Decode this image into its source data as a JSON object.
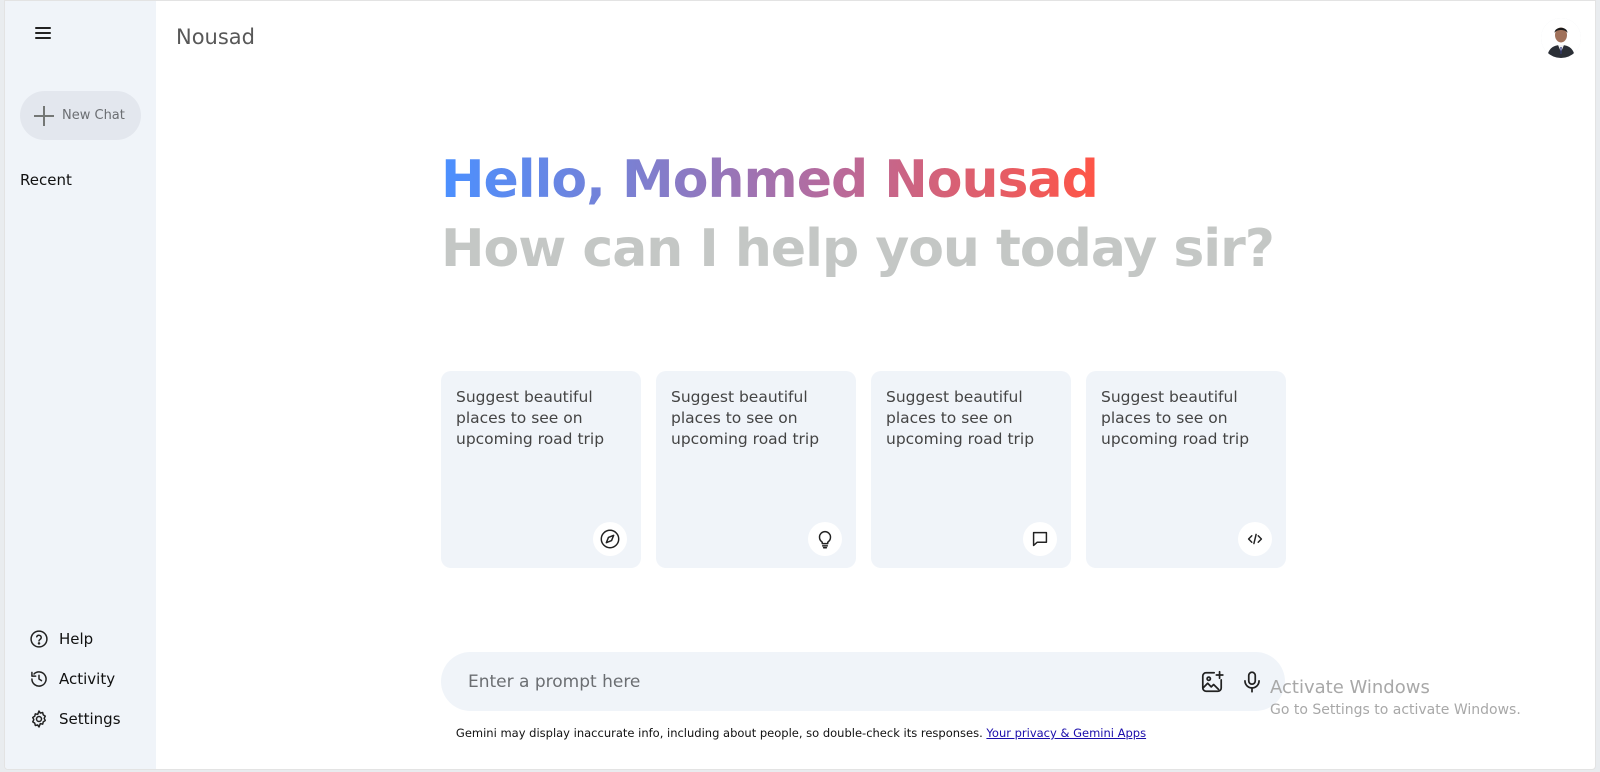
{
  "sidebar": {
    "new_chat_label": "New Chat",
    "recent_title": "Recent",
    "bottom_items": [
      {
        "label": "Help",
        "icon": "help-icon"
      },
      {
        "label": "Activity",
        "icon": "history-icon"
      },
      {
        "label": "Settings",
        "icon": "gear-icon"
      }
    ]
  },
  "topbar": {
    "title": "Nousad"
  },
  "greeting": {
    "hello": "Hello, Mohmed Nousad",
    "subtitle": "How can I help you today sir?"
  },
  "cards": [
    {
      "text": "Suggest beautiful places to see on upcoming road trip",
      "icon": "compass-icon"
    },
    {
      "text": "Suggest beautiful places to see on upcoming road trip",
      "icon": "bulb-icon"
    },
    {
      "text": "Suggest beautiful places to see on upcoming road trip",
      "icon": "message-icon"
    },
    {
      "text": "Suggest beautiful places to see on upcoming road trip",
      "icon": "code-icon"
    }
  ],
  "prompt": {
    "placeholder": "Enter a prompt here",
    "value": ""
  },
  "disclaimer": {
    "text": "Gemini may display inaccurate info, including about people, so double-check its responses. ",
    "link": "Your privacy & Gemini Apps"
  },
  "watermark": {
    "line1": "Activate Windows",
    "line2": "Go to Settings to activate Windows."
  },
  "colors": {
    "sidebar_bg": "#f0f4f9",
    "gradient_start": "#4b90ff",
    "gradient_end": "#ff5546",
    "subtitle": "#c4c7c5"
  }
}
